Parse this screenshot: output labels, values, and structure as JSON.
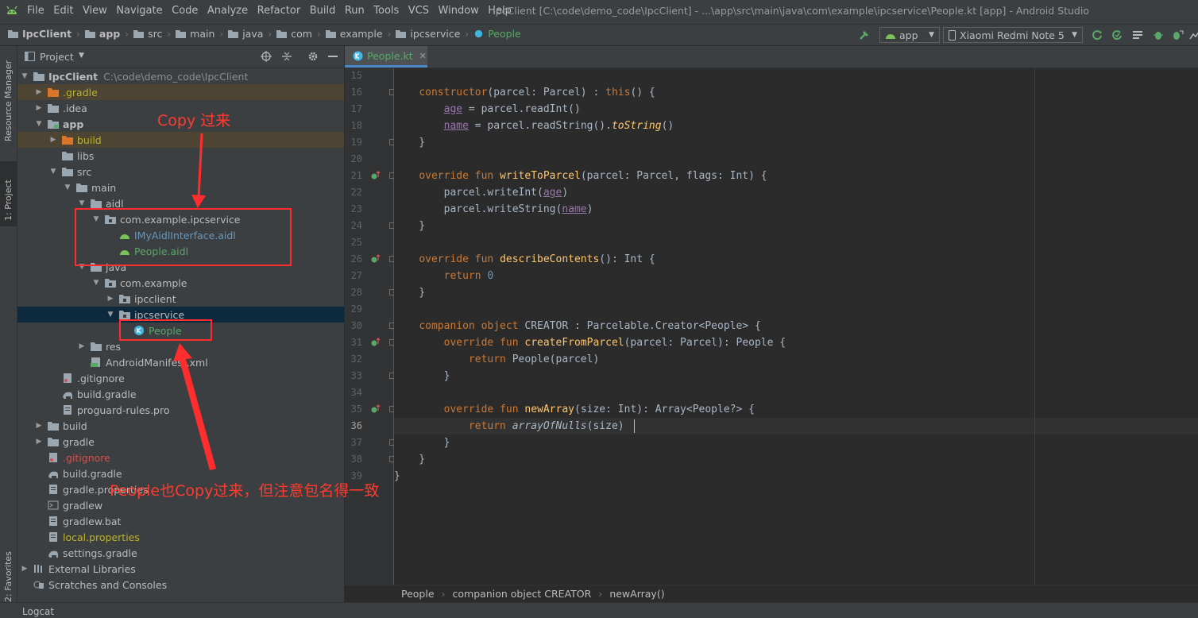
{
  "menu": [
    "File",
    "Edit",
    "View",
    "Navigate",
    "Code",
    "Analyze",
    "Refactor",
    "Build",
    "Run",
    "Tools",
    "VCS",
    "Window",
    "Help"
  ],
  "window_title": "IpcClient [C:\\code\\demo_code\\IpcClient] - ...\\app\\src\\main\\java\\com\\example\\ipcservice\\People.kt [app] - Android Studio",
  "breadcrumbs": [
    "IpcClient",
    "app",
    "src",
    "main",
    "java",
    "com",
    "example",
    "ipcservice",
    "People"
  ],
  "toolbar": {
    "run_config": "app",
    "device": "Xiaomi Redmi Note 5"
  },
  "side_tabs": {
    "resource_manager": "Resource Manager",
    "project": "1: Project",
    "favorites": "2: Favorites"
  },
  "project_panel": {
    "title": "Project",
    "tree": [
      {
        "label": "IpcClient",
        "path": "C:\\code\\demo_code\\IpcClient",
        "level": 0,
        "arrow": "down",
        "icon": "folder-icon",
        "style": "bold"
      },
      {
        "label": ".gradle",
        "level": 1,
        "arrow": "right",
        "icon": "folder-orange-icon",
        "style": "gold",
        "hl": "orange"
      },
      {
        "label": ".idea",
        "level": 1,
        "arrow": "right",
        "icon": "folder-icon",
        "style": ""
      },
      {
        "label": "app",
        "level": 1,
        "arrow": "down",
        "icon": "module-folder-icon",
        "style": "bold"
      },
      {
        "label": "build",
        "level": 2,
        "arrow": "right",
        "icon": "folder-orange-icon",
        "style": "gold",
        "hl": "orange"
      },
      {
        "label": "libs",
        "level": 2,
        "arrow": "",
        "icon": "folder-icon",
        "style": ""
      },
      {
        "label": "src",
        "level": 2,
        "arrow": "down",
        "icon": "folder-icon",
        "style": ""
      },
      {
        "label": "main",
        "level": 3,
        "arrow": "down",
        "icon": "folder-icon",
        "style": ""
      },
      {
        "label": "aidl",
        "level": 4,
        "arrow": "down",
        "icon": "folder-icon",
        "style": ""
      },
      {
        "label": "com.example.ipcservice",
        "level": 5,
        "arrow": "down",
        "icon": "package-icon",
        "style": ""
      },
      {
        "label": "IMyAidlInterface.aidl",
        "level": 6,
        "arrow": "",
        "icon": "android-icon",
        "style": "blue"
      },
      {
        "label": "People.aidl",
        "level": 6,
        "arrow": "",
        "icon": "android-icon",
        "style": "green"
      },
      {
        "label": "java",
        "level": 4,
        "arrow": "down",
        "icon": "folder-icon",
        "style": ""
      },
      {
        "label": "com.example",
        "level": 5,
        "arrow": "down",
        "icon": "package-icon",
        "style": ""
      },
      {
        "label": "ipcclient",
        "level": 6,
        "arrow": "right",
        "icon": "package-icon",
        "style": ""
      },
      {
        "label": "ipcservice",
        "level": 6,
        "arrow": "down",
        "icon": "package-icon",
        "style": "",
        "hl": "sel"
      },
      {
        "label": "People",
        "level": 7,
        "arrow": "",
        "icon": "kotlin-class-icon",
        "style": "green"
      },
      {
        "label": "res",
        "level": 4,
        "arrow": "right",
        "icon": "folder-icon",
        "style": ""
      },
      {
        "label": "AndroidManifest.xml",
        "level": 4,
        "arrow": "",
        "icon": "manifest-icon",
        "style": ""
      },
      {
        "label": ".gitignore",
        "level": 2,
        "arrow": "",
        "icon": "gitignore-icon",
        "style": ""
      },
      {
        "label": "build.gradle",
        "level": 2,
        "arrow": "",
        "icon": "gradle-icon",
        "style": ""
      },
      {
        "label": "proguard-rules.pro",
        "level": 2,
        "arrow": "",
        "icon": "file-icon",
        "style": ""
      },
      {
        "label": "build",
        "level": 1,
        "arrow": "right",
        "icon": "folder-icon",
        "style": ""
      },
      {
        "label": "gradle",
        "level": 1,
        "arrow": "right",
        "icon": "folder-icon",
        "style": ""
      },
      {
        "label": ".gitignore",
        "level": 1,
        "arrow": "",
        "icon": "gitignore-icon",
        "style": "red"
      },
      {
        "label": "build.gradle",
        "level": 1,
        "arrow": "",
        "icon": "gradle-icon",
        "style": ""
      },
      {
        "label": "gradle.properties",
        "level": 1,
        "arrow": "",
        "icon": "file-icon",
        "style": ""
      },
      {
        "label": "gradlew",
        "level": 1,
        "arrow": "",
        "icon": "terminal-icon",
        "style": ""
      },
      {
        "label": "gradlew.bat",
        "level": 1,
        "arrow": "",
        "icon": "file-icon",
        "style": ""
      },
      {
        "label": "local.properties",
        "level": 1,
        "arrow": "",
        "icon": "file-icon",
        "style": "gold"
      },
      {
        "label": "settings.gradle",
        "level": 1,
        "arrow": "",
        "icon": "gradle-icon",
        "style": ""
      },
      {
        "label": "External Libraries",
        "level": 0,
        "arrow": "right",
        "icon": "library-icon",
        "style": ""
      },
      {
        "label": "Scratches and Consoles",
        "level": 0,
        "arrow": "",
        "icon": "scratch-icon",
        "style": ""
      }
    ]
  },
  "editor": {
    "tab": "People.kt",
    "current_line": 36,
    "lines": [
      {
        "n": 15,
        "code": ""
      },
      {
        "n": 16,
        "code": "    <span class=\"kw\">constructor</span>(parcel: Parcel) : <span class=\"kw\">this</span>() {"
      },
      {
        "n": 17,
        "code": "        <span class=\"pr\">age</span> = parcel.readInt()"
      },
      {
        "n": 18,
        "code": "        <span class=\"pr\">name</span> = parcel.readString().<span class=\"fn it\">toString</span>()"
      },
      {
        "n": 19,
        "code": "    }"
      },
      {
        "n": 20,
        "code": ""
      },
      {
        "n": 21,
        "code": "    <span class=\"kw\">override fun</span> <span class=\"fn\">writeToParcel</span>(parcel: Parcel, flags: Int) {",
        "ov": true
      },
      {
        "n": 22,
        "code": "        parcel.writeInt(<span class=\"pr\">age</span>)"
      },
      {
        "n": 23,
        "code": "        parcel.writeString(<span class=\"pr\">name</span>)"
      },
      {
        "n": 24,
        "code": "    }"
      },
      {
        "n": 25,
        "code": ""
      },
      {
        "n": 26,
        "code": "    <span class=\"kw\">override fun</span> <span class=\"fn\">describeContents</span>(): Int {",
        "ov": true
      },
      {
        "n": 27,
        "code": "        <span class=\"kw\">return</span> <span class=\"num\">0</span>"
      },
      {
        "n": 28,
        "code": "    }"
      },
      {
        "n": 29,
        "code": ""
      },
      {
        "n": 30,
        "code": "    <span class=\"kw\">companion object</span> CREATOR : Parcelable.Creator&lt;People&gt; {"
      },
      {
        "n": 31,
        "code": "        <span class=\"kw\">override fun</span> <span class=\"fn\">createFromParcel</span>(parcel: Parcel): People {",
        "ov": true
      },
      {
        "n": 32,
        "code": "            <span class=\"kw\">return</span> People(parcel)"
      },
      {
        "n": 33,
        "code": "        }"
      },
      {
        "n": 34,
        "code": ""
      },
      {
        "n": 35,
        "code": "        <span class=\"kw\">override fun</span> <span class=\"fn\">newArray</span>(size: Int): Array&lt;People?&gt; {",
        "ov": true
      },
      {
        "n": 36,
        "code": "            <span class=\"kw\">return</span> <span class=\"it\">arrayOfNulls</span>(size)"
      },
      {
        "n": 37,
        "code": "        }"
      },
      {
        "n": 38,
        "code": "    }"
      },
      {
        "n": 39,
        "code": "}"
      }
    ],
    "status_breadcrumb": [
      "People",
      "companion object CREATOR",
      "newArray()"
    ]
  },
  "bottom_bar": {
    "logcat": "Logcat"
  },
  "annotations": {
    "copy_label": "Copy 过来",
    "people_label": "People也Copy过来，但注意包名得一致"
  },
  "colors": {
    "annotation": "#ff2d2d",
    "bg": "#2b2b2b",
    "panel": "#3c3f41"
  }
}
